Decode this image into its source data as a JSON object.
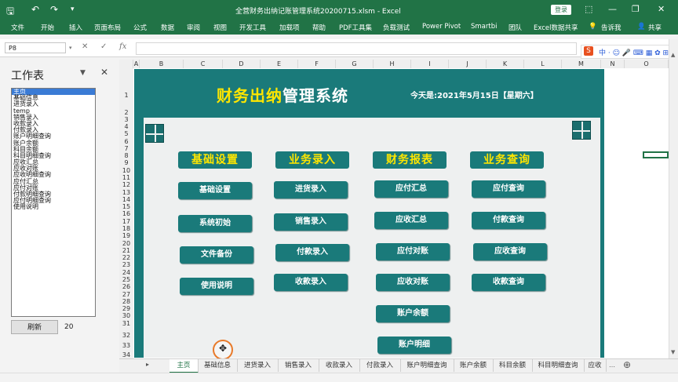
{
  "window": {
    "title": "全营财务出纳记账管理系统20200715.xlsm  -  Excel",
    "login_label": "登录",
    "minimize": "—",
    "restore": "❐",
    "close": "✕"
  },
  "ribbon": {
    "tabs": [
      "文件",
      "开始",
      "插入",
      "页面布局",
      "公式",
      "数据",
      "审阅",
      "视图",
      "开发工具",
      "加载项",
      "帮助",
      "PDF工具集",
      "负载测试",
      "Power Pivot",
      "Smartbi",
      "团队",
      "Excel数据共享"
    ],
    "tell_me": "告诉我",
    "share": "共享"
  },
  "formula_bar": {
    "name_box": "P8",
    "cancel": "✕",
    "enter": "✓",
    "fx": "fx",
    "value": ""
  },
  "sidebar": {
    "title": "工作表",
    "items": [
      "主页",
      "基础信息",
      "进货录入",
      "temp",
      "销售录入",
      "收款录入",
      "付款录入",
      "账户明细查询",
      "账户余额",
      "科目余额",
      "科目明细查询",
      "应收汇总",
      "应收对账",
      "应收明细查询",
      "应付汇总",
      "应付对账",
      "付款明细查询",
      "应付明细查询",
      "使用说明"
    ],
    "selected_index": 0,
    "refresh_label": "刷新",
    "count": "20"
  },
  "grid": {
    "columns": [
      "A",
      "B",
      "C",
      "D",
      "E",
      "F",
      "G",
      "H",
      "I",
      "J",
      "K",
      "L",
      "M",
      "N",
      "O"
    ],
    "rows": [
      "1",
      "2",
      "3",
      "4",
      "5",
      "6",
      "7",
      "8",
      "9",
      "10",
      "11",
      "12",
      "13",
      "14",
      "15",
      "16",
      "17",
      "18",
      "19",
      "20",
      "21",
      "22",
      "23",
      "24",
      "25",
      "26",
      "27",
      "28",
      "29",
      "30",
      "31",
      "32",
      "33",
      "34"
    ]
  },
  "dashboard": {
    "title_yellow": "财务出纳",
    "title_white": "管理系统",
    "date_label": "今天是:2021年5月15日【星期六】",
    "categories": [
      {
        "label": "基础设置",
        "buttons": [
          "基础设置",
          "系统初始",
          "文件备份",
          "使用说明"
        ]
      },
      {
        "label": "业务录入",
        "buttons": [
          "进货录入",
          "销售录入",
          "付款录入",
          "收款录入"
        ]
      },
      {
        "label": "财务报表",
        "buttons": [
          "应付汇总",
          "应收汇总",
          "应付对账",
          "应收对账",
          "账户余额",
          "账户明细"
        ]
      },
      {
        "label": "业务查询",
        "buttons": [
          "应付查询",
          "付款查询",
          "应收查询",
          "收款查询"
        ]
      }
    ]
  },
  "sheet_tabs": {
    "tabs": [
      "主页",
      "基础信息",
      "进货录入",
      "销售录入",
      "收款录入",
      "付款录入",
      "账户明细查询",
      "账户余额",
      "科目余额",
      "科目明细查询",
      "应收"
    ],
    "active_index": 0,
    "add": "⊕"
  },
  "colors": {
    "excel_green": "#217346",
    "dashboard_teal": "#1a7a7a",
    "title_yellow": "#ffe600"
  }
}
